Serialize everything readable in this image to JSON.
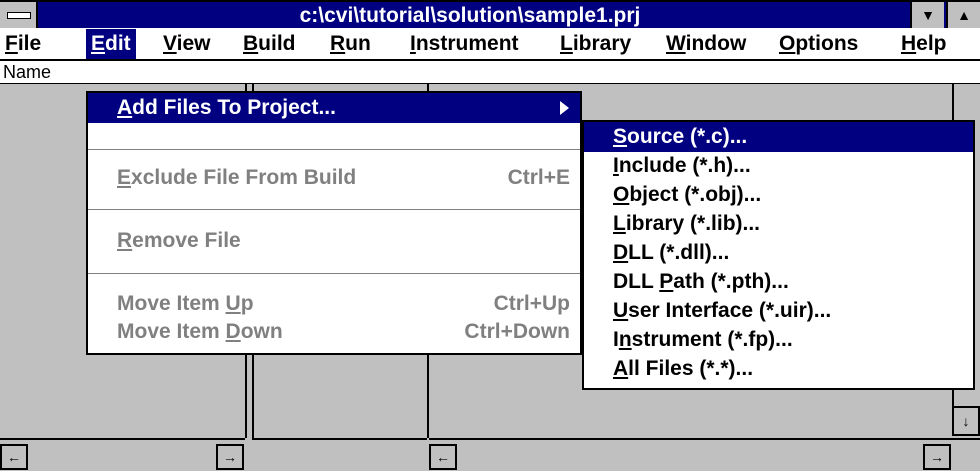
{
  "window": {
    "title": "c:\\cvi\\tutorial\\solution\\sample1.prj"
  },
  "menubar": [
    {
      "pre": "",
      "u": "F",
      "post": "ile"
    },
    {
      "pre": "",
      "u": "E",
      "post": "dit"
    },
    {
      "pre": "",
      "u": "V",
      "post": "iew"
    },
    {
      "pre": "",
      "u": "B",
      "post": "uild"
    },
    {
      "pre": "",
      "u": "R",
      "post": "un"
    },
    {
      "pre": "",
      "u": "I",
      "post": "nstrument"
    },
    {
      "pre": "",
      "u": "L",
      "post": "ibrary"
    },
    {
      "pre": "",
      "u": "W",
      "post": "indow"
    },
    {
      "pre": "",
      "u": "O",
      "post": "ptions"
    },
    {
      "pre": "",
      "u": "H",
      "post": "elp"
    }
  ],
  "header": {
    "name_label": "Name"
  },
  "edit_menu": {
    "add_files": {
      "pre": "",
      "u": "A",
      "post": "dd Files To Project..."
    },
    "exclude": {
      "pre": "",
      "u": "E",
      "post": "xclude File From Build",
      "shortcut": "Ctrl+E"
    },
    "remove": {
      "pre": "",
      "u": "R",
      "post": "emove File"
    },
    "move_up": {
      "pre": "Move Item ",
      "u": "U",
      "post": "p",
      "shortcut": "Ctrl+Up"
    },
    "move_down": {
      "pre": "Move Item ",
      "u": "D",
      "post": "own",
      "shortcut": "Ctrl+Down"
    }
  },
  "submenu": [
    {
      "pre": "",
      "u": "S",
      "post": "ource (*.c)..."
    },
    {
      "pre": "",
      "u": "I",
      "post": "nclude (*.h)..."
    },
    {
      "pre": "",
      "u": "O",
      "post": "bject (*.obj)..."
    },
    {
      "pre": "",
      "u": "L",
      "post": "ibrary (*.lib)..."
    },
    {
      "pre": "",
      "u": "D",
      "post": "LL (*.dll)..."
    },
    {
      "pre": "DLL ",
      "u": "P",
      "post": "ath (*.pth)..."
    },
    {
      "pre": "",
      "u": "U",
      "post": "ser Interface (*.uir)..."
    },
    {
      "pre": "I",
      "u": "n",
      "post": "strument (*.fp)..."
    },
    {
      "pre": "",
      "u": "A",
      "post": "ll Files (*.*)..."
    }
  ]
}
